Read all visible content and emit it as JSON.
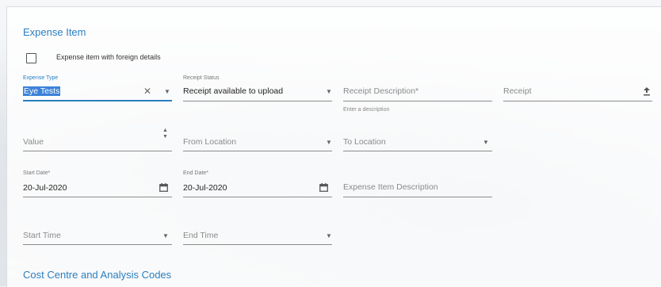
{
  "expense_item": {
    "title": "Expense Item",
    "foreign_checkbox_label": "Expense item with foreign details",
    "expense_type": {
      "label": "Expense Type",
      "value": "Eye Tests"
    },
    "receipt_status": {
      "label": "Receipt Status",
      "value": "Receipt available to upload"
    },
    "receipt_description": {
      "placeholder": "Receipt Description",
      "required_mark": "*",
      "hint": "Enter a description"
    },
    "receipt": {
      "placeholder": "Receipt"
    },
    "value": {
      "placeholder": "Value"
    },
    "from_location": {
      "placeholder": "From Location"
    },
    "to_location": {
      "placeholder": "To Location"
    },
    "start_date": {
      "label": "Start Date",
      "required_mark": "*",
      "value": "20-Jul-2020"
    },
    "end_date": {
      "label": "End Date",
      "required_mark": "*",
      "value": "20-Jul-2020"
    },
    "item_description": {
      "placeholder": "Expense Item Description"
    },
    "start_time": {
      "placeholder": "Start Time"
    },
    "end_time": {
      "placeholder": "End Time"
    }
  },
  "cost_centre": {
    "title": "Cost Centre and Analysis Codes"
  },
  "colors": {
    "accent": "#2a7fc0",
    "selection": "#3b82d8"
  }
}
